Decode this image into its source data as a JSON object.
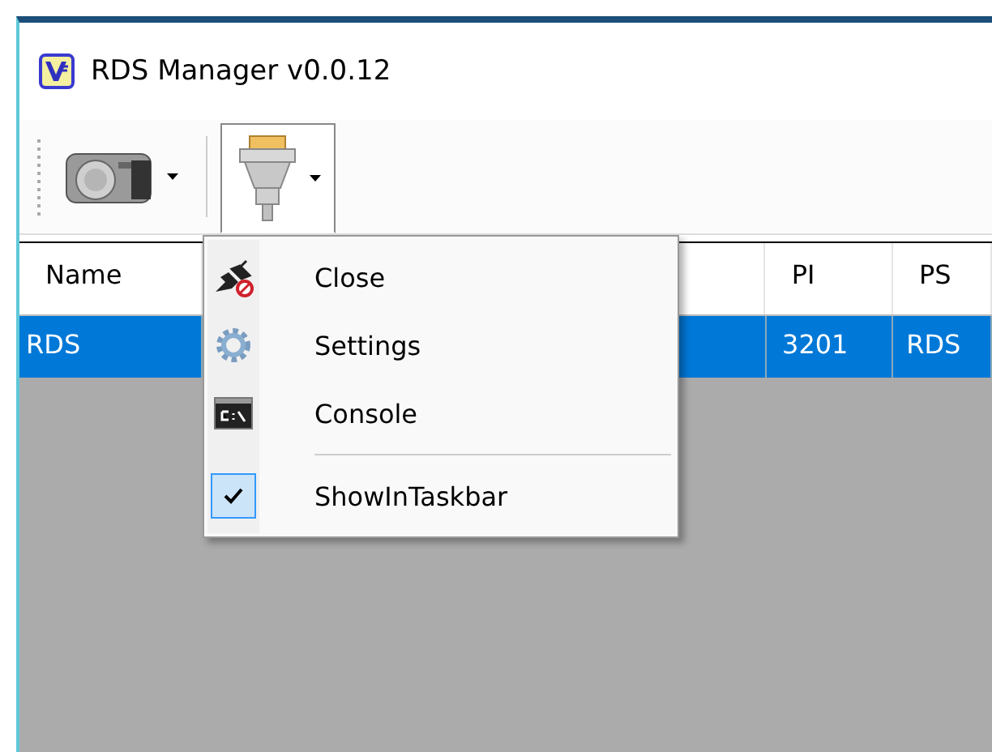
{
  "window": {
    "title": "RDS Manager v0.0.12"
  },
  "toolbar": {
    "buttons": [
      {
        "selected": false
      },
      {
        "selected": true
      }
    ]
  },
  "table": {
    "columns": [
      "Name",
      "PI",
      "PS"
    ],
    "rows": [
      {
        "selected": true,
        "cells": [
          "RDS",
          "3201",
          "RDS"
        ]
      }
    ]
  },
  "menu": {
    "items": [
      {
        "label": "Close",
        "checked": false
      },
      {
        "label": "Settings",
        "checked": false
      },
      {
        "label": "Console",
        "checked": false
      },
      {
        "label": "ShowInTaskbar",
        "checked": true
      }
    ]
  }
}
